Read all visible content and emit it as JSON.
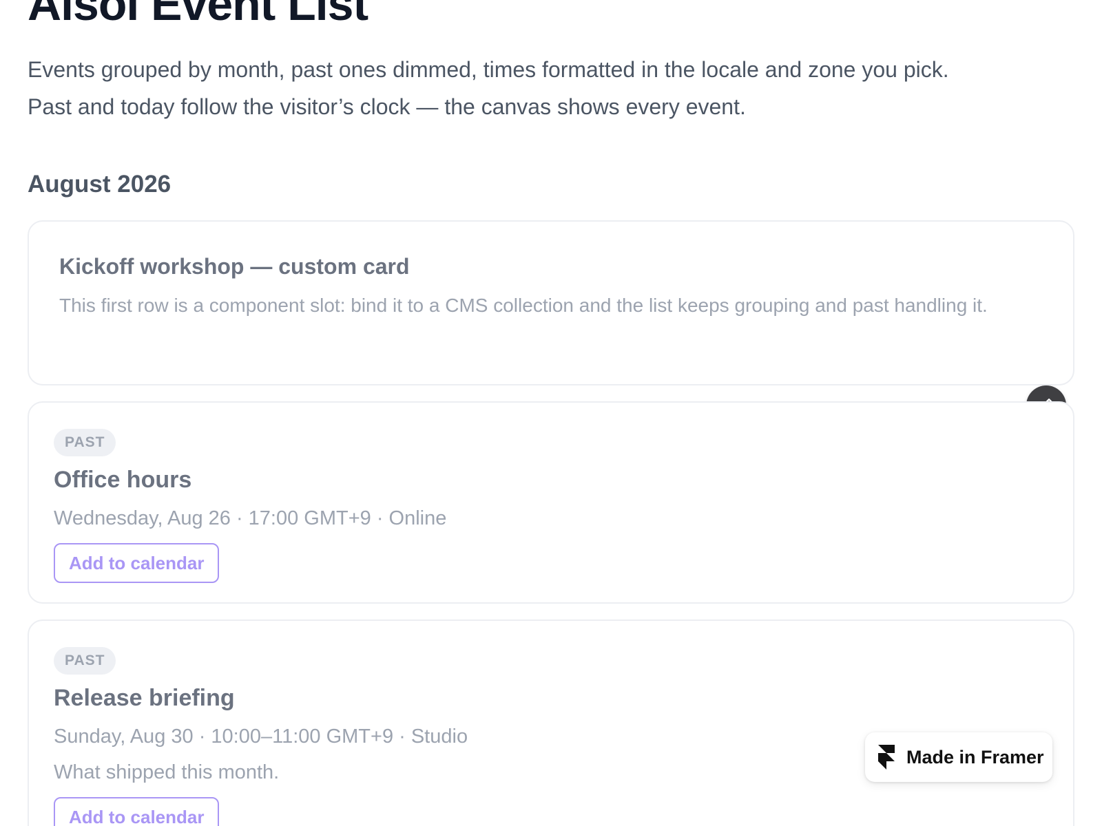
{
  "header": {
    "title": "Aisoi Event List",
    "intro_line1": "Events grouped by month, past ones dimmed, times formatted in the locale and zone you pick.",
    "intro_line2": "Past and today follow the visitor’s clock — the canvas shows every event."
  },
  "month": {
    "label": "August 2026"
  },
  "custom_card": {
    "title": "Kickoff workshop — custom card",
    "description": "This first row is a component slot: bind it to a CMS collection and the list keeps grouping and past handling it."
  },
  "events": [
    {
      "badge": "PAST",
      "title": "Office hours",
      "meta": "Wednesday, Aug 26 · 17:00 GMT+9 · Online",
      "button_label": "Add to calendar"
    },
    {
      "badge": "PAST",
      "title": "Release briefing",
      "meta": "Sunday, Aug 30 · 10:00–11:00 GMT+9 · Studio",
      "description": "What shipped this month.",
      "button_label": "Add to calendar"
    }
  ],
  "edit_button": {
    "icon": "pencil-icon"
  },
  "framer_badge": {
    "label": "Made in Framer",
    "icon": "framer-logo-icon"
  },
  "colors": {
    "title": "#111827",
    "muted_text": "#9ca3af",
    "card_border": "#eceef2",
    "accent": "#a996f5",
    "fab": "#3f3f42"
  }
}
